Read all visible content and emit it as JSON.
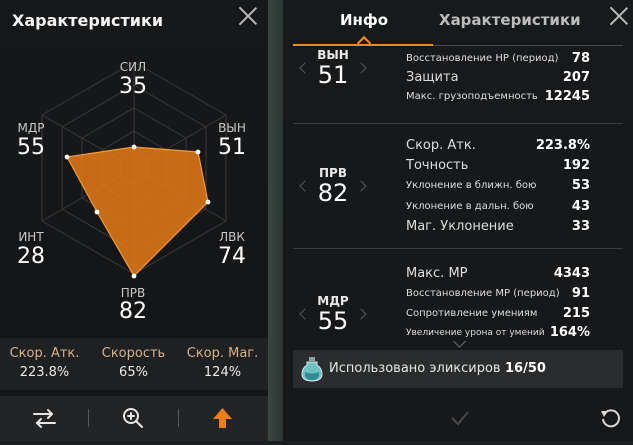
{
  "left_panel": {
    "title": "Характеристики",
    "stats": {
      "sil": {
        "label": "СИЛ",
        "value": "35"
      },
      "vyn": {
        "label": "ВЫН",
        "value": "51"
      },
      "lvk": {
        "label": "ЛВК",
        "value": "74"
      },
      "prv": {
        "label": "ПРВ",
        "value": "82"
      },
      "int": {
        "label": "ИНТ",
        "value": "28"
      },
      "mdr": {
        "label": "МДР",
        "value": "55"
      }
    },
    "bottom_stats": [
      {
        "label": "Скор. Атк.",
        "value": "223.8%"
      },
      {
        "label": "Скорость",
        "value": "65%"
      },
      {
        "label": "Скор. Маг.",
        "value": "124%"
      }
    ],
    "toolbar": {
      "swap_icon": "swap-arrows-icon",
      "zoom_icon": "zoom-in-icon",
      "upgrade_icon": "arrow-up-icon"
    },
    "accent_color": "#e87a16"
  },
  "right_panel": {
    "tabs": [
      {
        "label": "Инфо",
        "active": true
      },
      {
        "label": "Характеристики",
        "active": false
      }
    ],
    "sections": [
      {
        "abbr": "ВЫН",
        "value": "51",
        "rows": [
          {
            "label": "Восстановление HP (период)",
            "value": "78"
          },
          {
            "label": "Защита",
            "value": "207"
          },
          {
            "label": "Макс. грузоподъемность",
            "value": "12245"
          }
        ]
      },
      {
        "abbr": "ПРВ",
        "value": "82",
        "rows": [
          {
            "label": "Скор. Атк.",
            "value": "223.8%"
          },
          {
            "label": "Точность",
            "value": "192"
          },
          {
            "label": "Уклонение в ближн. бою",
            "value": "53"
          },
          {
            "label": "Уклонение в дальн. бою",
            "value": "43"
          },
          {
            "label": "Маг. Уклонение",
            "value": "33"
          }
        ]
      },
      {
        "abbr": "МДР",
        "value": "55",
        "rows": [
          {
            "label": "Макс. МР",
            "value": "4343"
          },
          {
            "label": "Восстановление МР (период)",
            "value": "91"
          },
          {
            "label": "Сопротивление умениям",
            "value": "215"
          },
          {
            "label": "Увеличение урона от умений",
            "value": "164%"
          }
        ]
      }
    ],
    "elixir": {
      "label": "Использовано эликсиров",
      "value": "16/50",
      "icon": "elixir-bottle-icon"
    },
    "bottom_icons": {
      "confirm": "checkmark-icon",
      "reset": "reset-icon",
      "close": "close-icon"
    }
  }
}
